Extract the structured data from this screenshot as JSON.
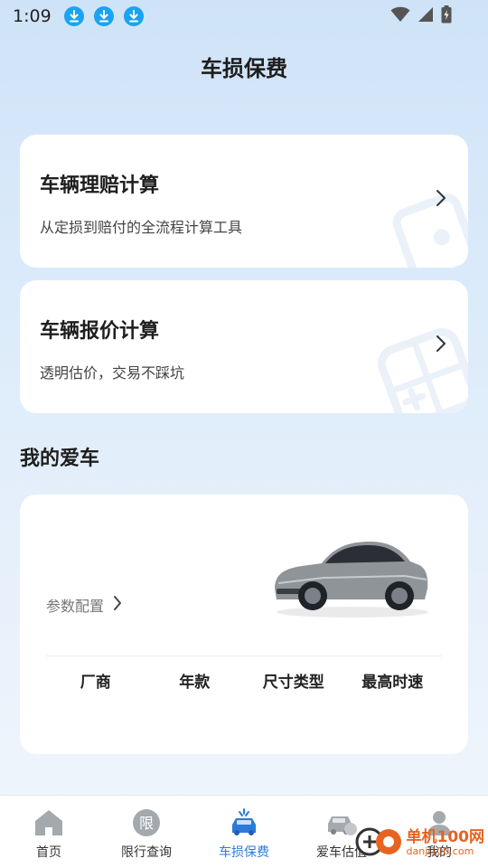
{
  "status_bar": {
    "time": "1:09"
  },
  "header": {
    "title": "车损保费"
  },
  "features": [
    {
      "title": "车辆理赔计算",
      "subtitle": "从定损到赔付的全流程计算工具"
    },
    {
      "title": "车辆报价计算",
      "subtitle": "透明估价，交易不踩坑"
    }
  ],
  "my_car": {
    "section_title": "我的爱车",
    "params_label": "参数配置",
    "specs": [
      "厂商",
      "年款",
      "尺寸类型",
      "最高时速"
    ]
  },
  "nav": {
    "items": [
      {
        "label": "首页",
        "icon": "home-icon"
      },
      {
        "label": "限行查询",
        "icon": "restriction-icon"
      },
      {
        "label": "车损保费",
        "icon": "car-damage-icon",
        "active": true
      },
      {
        "label": "爱车估值",
        "icon": "car-valuation-icon"
      },
      {
        "label": "我的",
        "icon": "profile-icon"
      }
    ]
  },
  "watermark": {
    "brand": "单机100网",
    "domain": "danji100.com"
  },
  "colors": {
    "accent": "#2b7bd9",
    "download_badge": "#1aa3f0",
    "watermark": "#e8631f"
  }
}
